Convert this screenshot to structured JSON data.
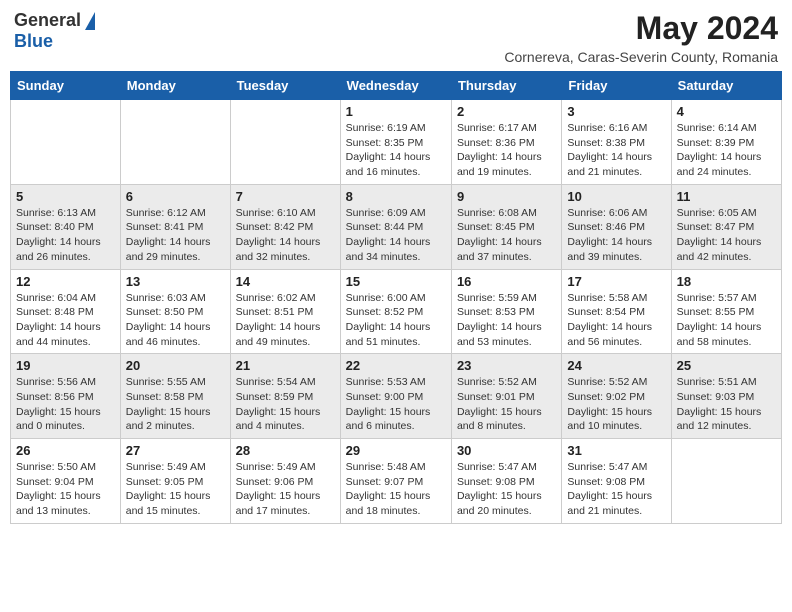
{
  "logo": {
    "general": "General",
    "blue": "Blue"
  },
  "title": "May 2024",
  "location": "Cornereva, Caras-Severin County, Romania",
  "weekdays": [
    "Sunday",
    "Monday",
    "Tuesday",
    "Wednesday",
    "Thursday",
    "Friday",
    "Saturday"
  ],
  "weeks": [
    [
      {
        "day": "",
        "sunrise": "",
        "sunset": "",
        "daylight": ""
      },
      {
        "day": "",
        "sunrise": "",
        "sunset": "",
        "daylight": ""
      },
      {
        "day": "",
        "sunrise": "",
        "sunset": "",
        "daylight": ""
      },
      {
        "day": "1",
        "sunrise": "Sunrise: 6:19 AM",
        "sunset": "Sunset: 8:35 PM",
        "daylight": "Daylight: 14 hours and 16 minutes."
      },
      {
        "day": "2",
        "sunrise": "Sunrise: 6:17 AM",
        "sunset": "Sunset: 8:36 PM",
        "daylight": "Daylight: 14 hours and 19 minutes."
      },
      {
        "day": "3",
        "sunrise": "Sunrise: 6:16 AM",
        "sunset": "Sunset: 8:38 PM",
        "daylight": "Daylight: 14 hours and 21 minutes."
      },
      {
        "day": "4",
        "sunrise": "Sunrise: 6:14 AM",
        "sunset": "Sunset: 8:39 PM",
        "daylight": "Daylight: 14 hours and 24 minutes."
      }
    ],
    [
      {
        "day": "5",
        "sunrise": "Sunrise: 6:13 AM",
        "sunset": "Sunset: 8:40 PM",
        "daylight": "Daylight: 14 hours and 26 minutes."
      },
      {
        "day": "6",
        "sunrise": "Sunrise: 6:12 AM",
        "sunset": "Sunset: 8:41 PM",
        "daylight": "Daylight: 14 hours and 29 minutes."
      },
      {
        "day": "7",
        "sunrise": "Sunrise: 6:10 AM",
        "sunset": "Sunset: 8:42 PM",
        "daylight": "Daylight: 14 hours and 32 minutes."
      },
      {
        "day": "8",
        "sunrise": "Sunrise: 6:09 AM",
        "sunset": "Sunset: 8:44 PM",
        "daylight": "Daylight: 14 hours and 34 minutes."
      },
      {
        "day": "9",
        "sunrise": "Sunrise: 6:08 AM",
        "sunset": "Sunset: 8:45 PM",
        "daylight": "Daylight: 14 hours and 37 minutes."
      },
      {
        "day": "10",
        "sunrise": "Sunrise: 6:06 AM",
        "sunset": "Sunset: 8:46 PM",
        "daylight": "Daylight: 14 hours and 39 minutes."
      },
      {
        "day": "11",
        "sunrise": "Sunrise: 6:05 AM",
        "sunset": "Sunset: 8:47 PM",
        "daylight": "Daylight: 14 hours and 42 minutes."
      }
    ],
    [
      {
        "day": "12",
        "sunrise": "Sunrise: 6:04 AM",
        "sunset": "Sunset: 8:48 PM",
        "daylight": "Daylight: 14 hours and 44 minutes."
      },
      {
        "day": "13",
        "sunrise": "Sunrise: 6:03 AM",
        "sunset": "Sunset: 8:50 PM",
        "daylight": "Daylight: 14 hours and 46 minutes."
      },
      {
        "day": "14",
        "sunrise": "Sunrise: 6:02 AM",
        "sunset": "Sunset: 8:51 PM",
        "daylight": "Daylight: 14 hours and 49 minutes."
      },
      {
        "day": "15",
        "sunrise": "Sunrise: 6:00 AM",
        "sunset": "Sunset: 8:52 PM",
        "daylight": "Daylight: 14 hours and 51 minutes."
      },
      {
        "day": "16",
        "sunrise": "Sunrise: 5:59 AM",
        "sunset": "Sunset: 8:53 PM",
        "daylight": "Daylight: 14 hours and 53 minutes."
      },
      {
        "day": "17",
        "sunrise": "Sunrise: 5:58 AM",
        "sunset": "Sunset: 8:54 PM",
        "daylight": "Daylight: 14 hours and 56 minutes."
      },
      {
        "day": "18",
        "sunrise": "Sunrise: 5:57 AM",
        "sunset": "Sunset: 8:55 PM",
        "daylight": "Daylight: 14 hours and 58 minutes."
      }
    ],
    [
      {
        "day": "19",
        "sunrise": "Sunrise: 5:56 AM",
        "sunset": "Sunset: 8:56 PM",
        "daylight": "Daylight: 15 hours and 0 minutes."
      },
      {
        "day": "20",
        "sunrise": "Sunrise: 5:55 AM",
        "sunset": "Sunset: 8:58 PM",
        "daylight": "Daylight: 15 hours and 2 minutes."
      },
      {
        "day": "21",
        "sunrise": "Sunrise: 5:54 AM",
        "sunset": "Sunset: 8:59 PM",
        "daylight": "Daylight: 15 hours and 4 minutes."
      },
      {
        "day": "22",
        "sunrise": "Sunrise: 5:53 AM",
        "sunset": "Sunset: 9:00 PM",
        "daylight": "Daylight: 15 hours and 6 minutes."
      },
      {
        "day": "23",
        "sunrise": "Sunrise: 5:52 AM",
        "sunset": "Sunset: 9:01 PM",
        "daylight": "Daylight: 15 hours and 8 minutes."
      },
      {
        "day": "24",
        "sunrise": "Sunrise: 5:52 AM",
        "sunset": "Sunset: 9:02 PM",
        "daylight": "Daylight: 15 hours and 10 minutes."
      },
      {
        "day": "25",
        "sunrise": "Sunrise: 5:51 AM",
        "sunset": "Sunset: 9:03 PM",
        "daylight": "Daylight: 15 hours and 12 minutes."
      }
    ],
    [
      {
        "day": "26",
        "sunrise": "Sunrise: 5:50 AM",
        "sunset": "Sunset: 9:04 PM",
        "daylight": "Daylight: 15 hours and 13 minutes."
      },
      {
        "day": "27",
        "sunrise": "Sunrise: 5:49 AM",
        "sunset": "Sunset: 9:05 PM",
        "daylight": "Daylight: 15 hours and 15 minutes."
      },
      {
        "day": "28",
        "sunrise": "Sunrise: 5:49 AM",
        "sunset": "Sunset: 9:06 PM",
        "daylight": "Daylight: 15 hours and 17 minutes."
      },
      {
        "day": "29",
        "sunrise": "Sunrise: 5:48 AM",
        "sunset": "Sunset: 9:07 PM",
        "daylight": "Daylight: 15 hours and 18 minutes."
      },
      {
        "day": "30",
        "sunrise": "Sunrise: 5:47 AM",
        "sunset": "Sunset: 9:08 PM",
        "daylight": "Daylight: 15 hours and 20 minutes."
      },
      {
        "day": "31",
        "sunrise": "Sunrise: 5:47 AM",
        "sunset": "Sunset: 9:08 PM",
        "daylight": "Daylight: 15 hours and 21 minutes."
      },
      {
        "day": "",
        "sunrise": "",
        "sunset": "",
        "daylight": ""
      }
    ]
  ]
}
